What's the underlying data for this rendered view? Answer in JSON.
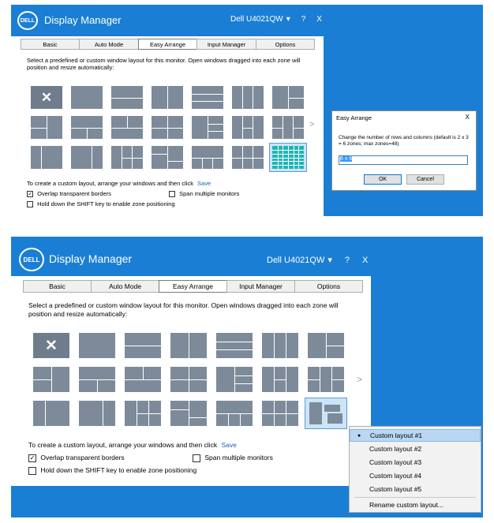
{
  "app": {
    "logo_text": "DELL",
    "title": "Display Manager",
    "monitor": "Dell U4021QW",
    "dropdown_glyph": "▾",
    "help": "?",
    "close": "X"
  },
  "tabs": [
    "Basic",
    "Auto Mode",
    "Easy Arrange",
    "Input Manager",
    "Options"
  ],
  "active_tab": "Easy Arrange",
  "description": "Select a predefined or custom window layout for this monitor.  Open windows dragged into each zone will position and resize automatically:",
  "next_arrow": ">",
  "footer": {
    "custom_text": "To create a custom layout, arrange your windows and then click",
    "save_link": "Save",
    "overlap_label": "Overlap transparent borders",
    "overlap_checked": true,
    "span_label": "Span multiple monitors",
    "span_checked": false,
    "shift_label": "Hold down the SHIFT key to enable zone positioning",
    "shift_checked": false
  },
  "dialog": {
    "title": "Easy Arrange",
    "close": "X",
    "message": "Change the number of rows and columns (default is 2 x 3 = 6 zones; max zones=48)",
    "input_value": "6 x 6",
    "ok": "OK",
    "cancel": "Cancel"
  },
  "menu": {
    "bullet": "●",
    "items": [
      "Custom layout #1",
      "Custom layout #2",
      "Custom layout #3",
      "Custom layout #4",
      "Custom layout #5"
    ],
    "selected_index": 0,
    "rename": "Rename custom layout..."
  },
  "colors": {
    "desktop": "#1a7fd4",
    "tile": "#7d8a99",
    "selection": "#cce4f7",
    "link": "#1a5fb4"
  }
}
